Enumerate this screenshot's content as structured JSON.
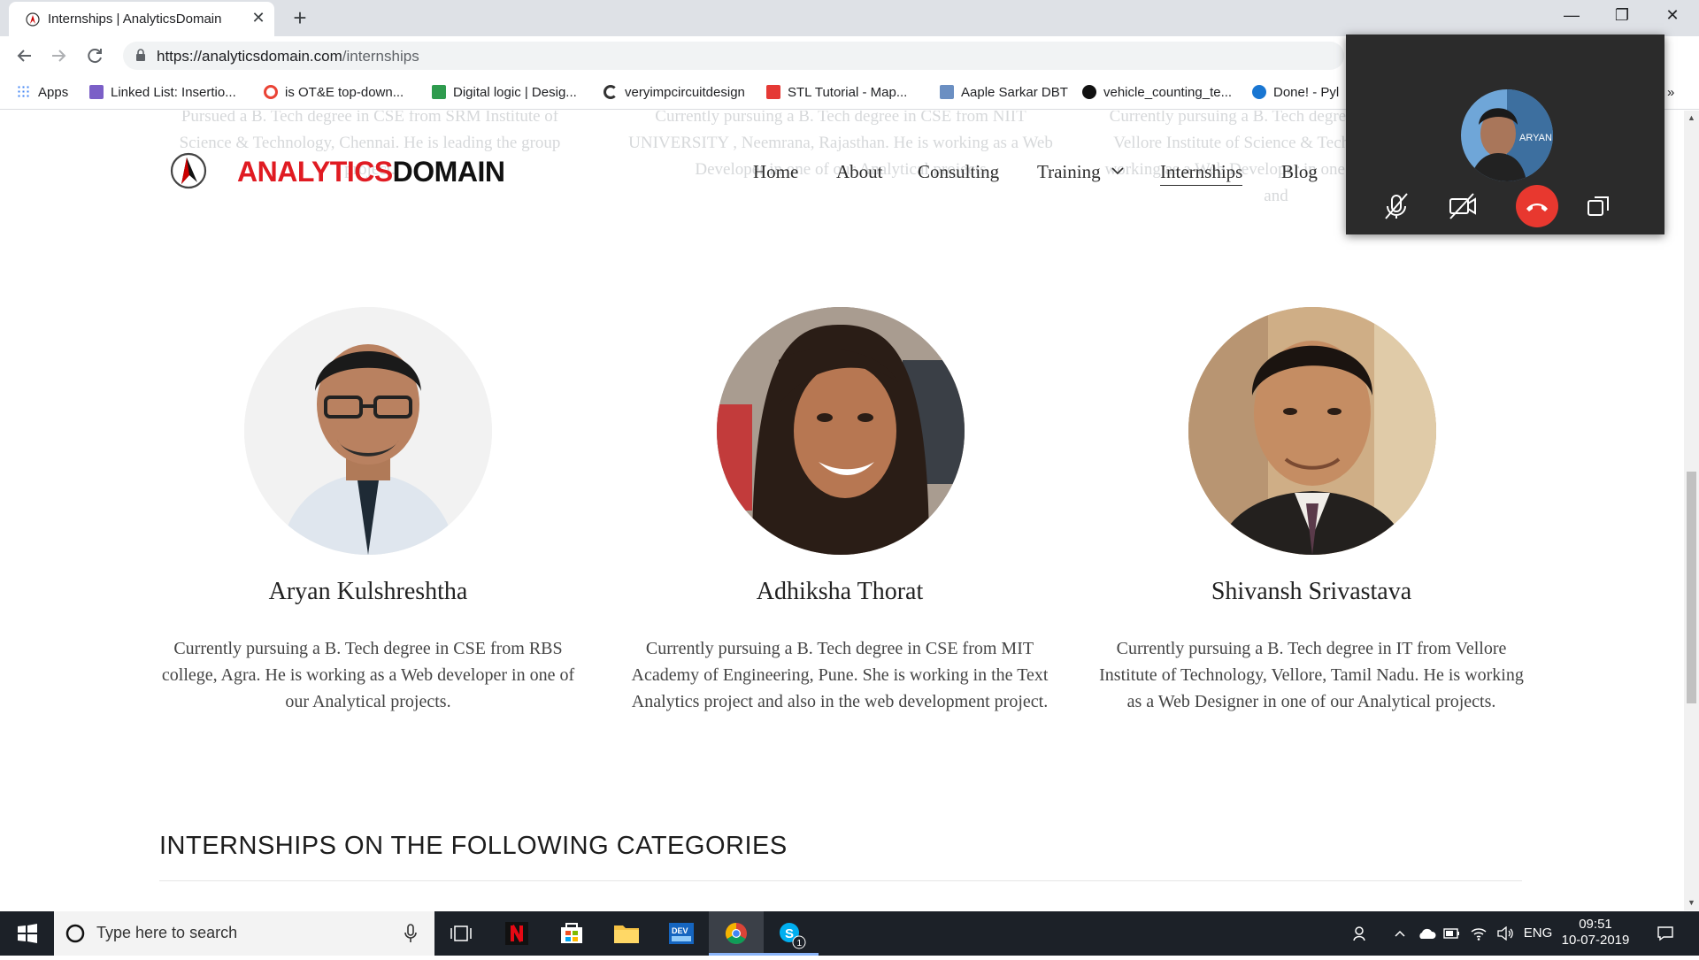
{
  "browser": {
    "tab_title": "Internships | AnalyticsDomain",
    "tab_close": "✕",
    "new_tab": "+",
    "url_host": "https://analyticsdomain.com",
    "url_path": "/internships",
    "window_controls": {
      "minimize": "—",
      "maximize": "❐",
      "close": "✕"
    },
    "bookmarks": [
      {
        "label": "Apps",
        "icon": "apps-grid-icon",
        "color": "#4285f4"
      },
      {
        "label": "Linked List: Insertio...",
        "icon": "geeksforgeeks-icon",
        "color": "#7b5fc7"
      },
      {
        "label": "is OT&E top-down...",
        "icon": "google-icon",
        "color": "#ea4335"
      },
      {
        "label": "Digital logic | Desig...",
        "icon": "dg-icon",
        "color": "#2e9b4e"
      },
      {
        "label": "veryimpcircuitdesign",
        "icon": "c-icon",
        "color": "#333333"
      },
      {
        "label": "STL Tutorial - Map...",
        "icon": "cpp-icon",
        "color": "#e53935"
      },
      {
        "label": "Aaple Sarkar DBT",
        "icon": "doc-icon",
        "color": "#6b8fc2"
      },
      {
        "label": "vehicle_counting_te...",
        "icon": "github-icon",
        "color": "#111111"
      },
      {
        "label": "Done! - Pyl",
        "icon": "p-icon",
        "color": "#1976d2"
      }
    ],
    "bookmarks_overflow": "»"
  },
  "site": {
    "logo_red": "ANALYTICS",
    "logo_black": "DOMAIN",
    "nav": [
      {
        "label": "Home",
        "active": false
      },
      {
        "label": "About",
        "active": false
      },
      {
        "label": "Consulting",
        "active": false
      },
      {
        "label": "Training",
        "active": false
      },
      {
        "label": "Internships",
        "active": true
      },
      {
        "label": "Blog",
        "active": false
      }
    ],
    "faded_bios": [
      "Pursued a B. Tech degree in CSE from SRM Institute of Science & Technology, Chennai. He is leading the group project.",
      "Currently pursuing  a  B. Tech degree in CSE from NIIT UNIVERSITY , Neemrana, Rajasthan. He is working as a Web Developer in one of our Analytical projects",
      "Currently pursuing  a B. Tech degree in CSE from Vellore Institute of Science & Technology. He is working as a Web Developer in one of our projects and"
    ],
    "people": [
      {
        "name": "Aryan Kulshreshtha",
        "bio": "Currently pursuing a B. Tech degree in CSE from RBS college, Agra. He is working as a Web developer in one of our Analytical projects."
      },
      {
        "name": "Adhiksha Thorat",
        "bio": "Currently pursuing a B. Tech degree in CSE from MIT Academy of Engineering, Pune. She is working in the Text Analytics project and also in the web development project."
      },
      {
        "name": "Shivansh Srivastava",
        "bio": "Currently pursuing a B. Tech degree in IT from Vellore Institute of Technology, Vellore, Tamil Nadu. He is working as a Web Designer in one of our Analytical projects."
      }
    ],
    "section_title": "INTERNSHIPS ON THE FOLLOWING CATEGORIES"
  },
  "call": {
    "caller_label": "ARYAN"
  },
  "taskbar": {
    "search_placeholder": "Type here to search",
    "language": "ENG",
    "time": "09:51",
    "date": "10-07-2019",
    "skype_badge": "1"
  }
}
